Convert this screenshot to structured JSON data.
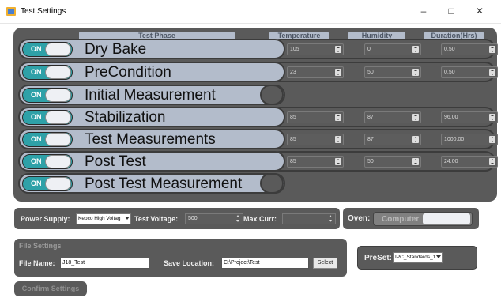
{
  "window": {
    "title": "Test Settings",
    "minimize": "–",
    "maximize": "□",
    "close": "✕"
  },
  "headers": {
    "phase": "Test Phase",
    "temperature": "Temperature",
    "humidity": "Humidity",
    "duration": "Duration(Hrs)"
  },
  "phases": [
    {
      "toggle": "ON",
      "label": "Dry Bake",
      "temperature": "105",
      "humidity": "0",
      "duration": "0.50"
    },
    {
      "toggle": "ON",
      "label": "PreCondition",
      "temperature": "23",
      "humidity": "50",
      "duration": "0.50"
    },
    {
      "toggle": "ON",
      "label": "Initial Measurement"
    },
    {
      "toggle": "ON",
      "label": "Stabilization",
      "temperature": "85",
      "humidity": "87",
      "duration": "96.00"
    },
    {
      "toggle": "ON",
      "label": "Test Measurements",
      "temperature": "85",
      "humidity": "87",
      "duration": "1000.00"
    },
    {
      "toggle": "ON",
      "label": "Post Test",
      "temperature": "85",
      "humidity": "50",
      "duration": "24.00"
    },
    {
      "toggle": "ON",
      "label": "Post Test Measurement"
    }
  ],
  "power": {
    "supply_label": "Power Supply:",
    "supply_value": "Kepco High Voltag",
    "voltage_label": "Test Voltage:",
    "voltage_value": "500",
    "maxcurr_label": "Max Curr:",
    "maxcurr_value": ""
  },
  "oven": {
    "label": "Oven:",
    "toggle": "Computer"
  },
  "file": {
    "section_title": "File Settings",
    "name_label": "File Name:",
    "name_value": "J18_Test",
    "location_label": "Save Location:",
    "location_value": "C:\\Project\\Test",
    "select_button": "Select"
  },
  "preset": {
    "label": "PreSet:",
    "value": "IPC_Standards_1"
  },
  "confirm_button": "Confirm Settings"
}
